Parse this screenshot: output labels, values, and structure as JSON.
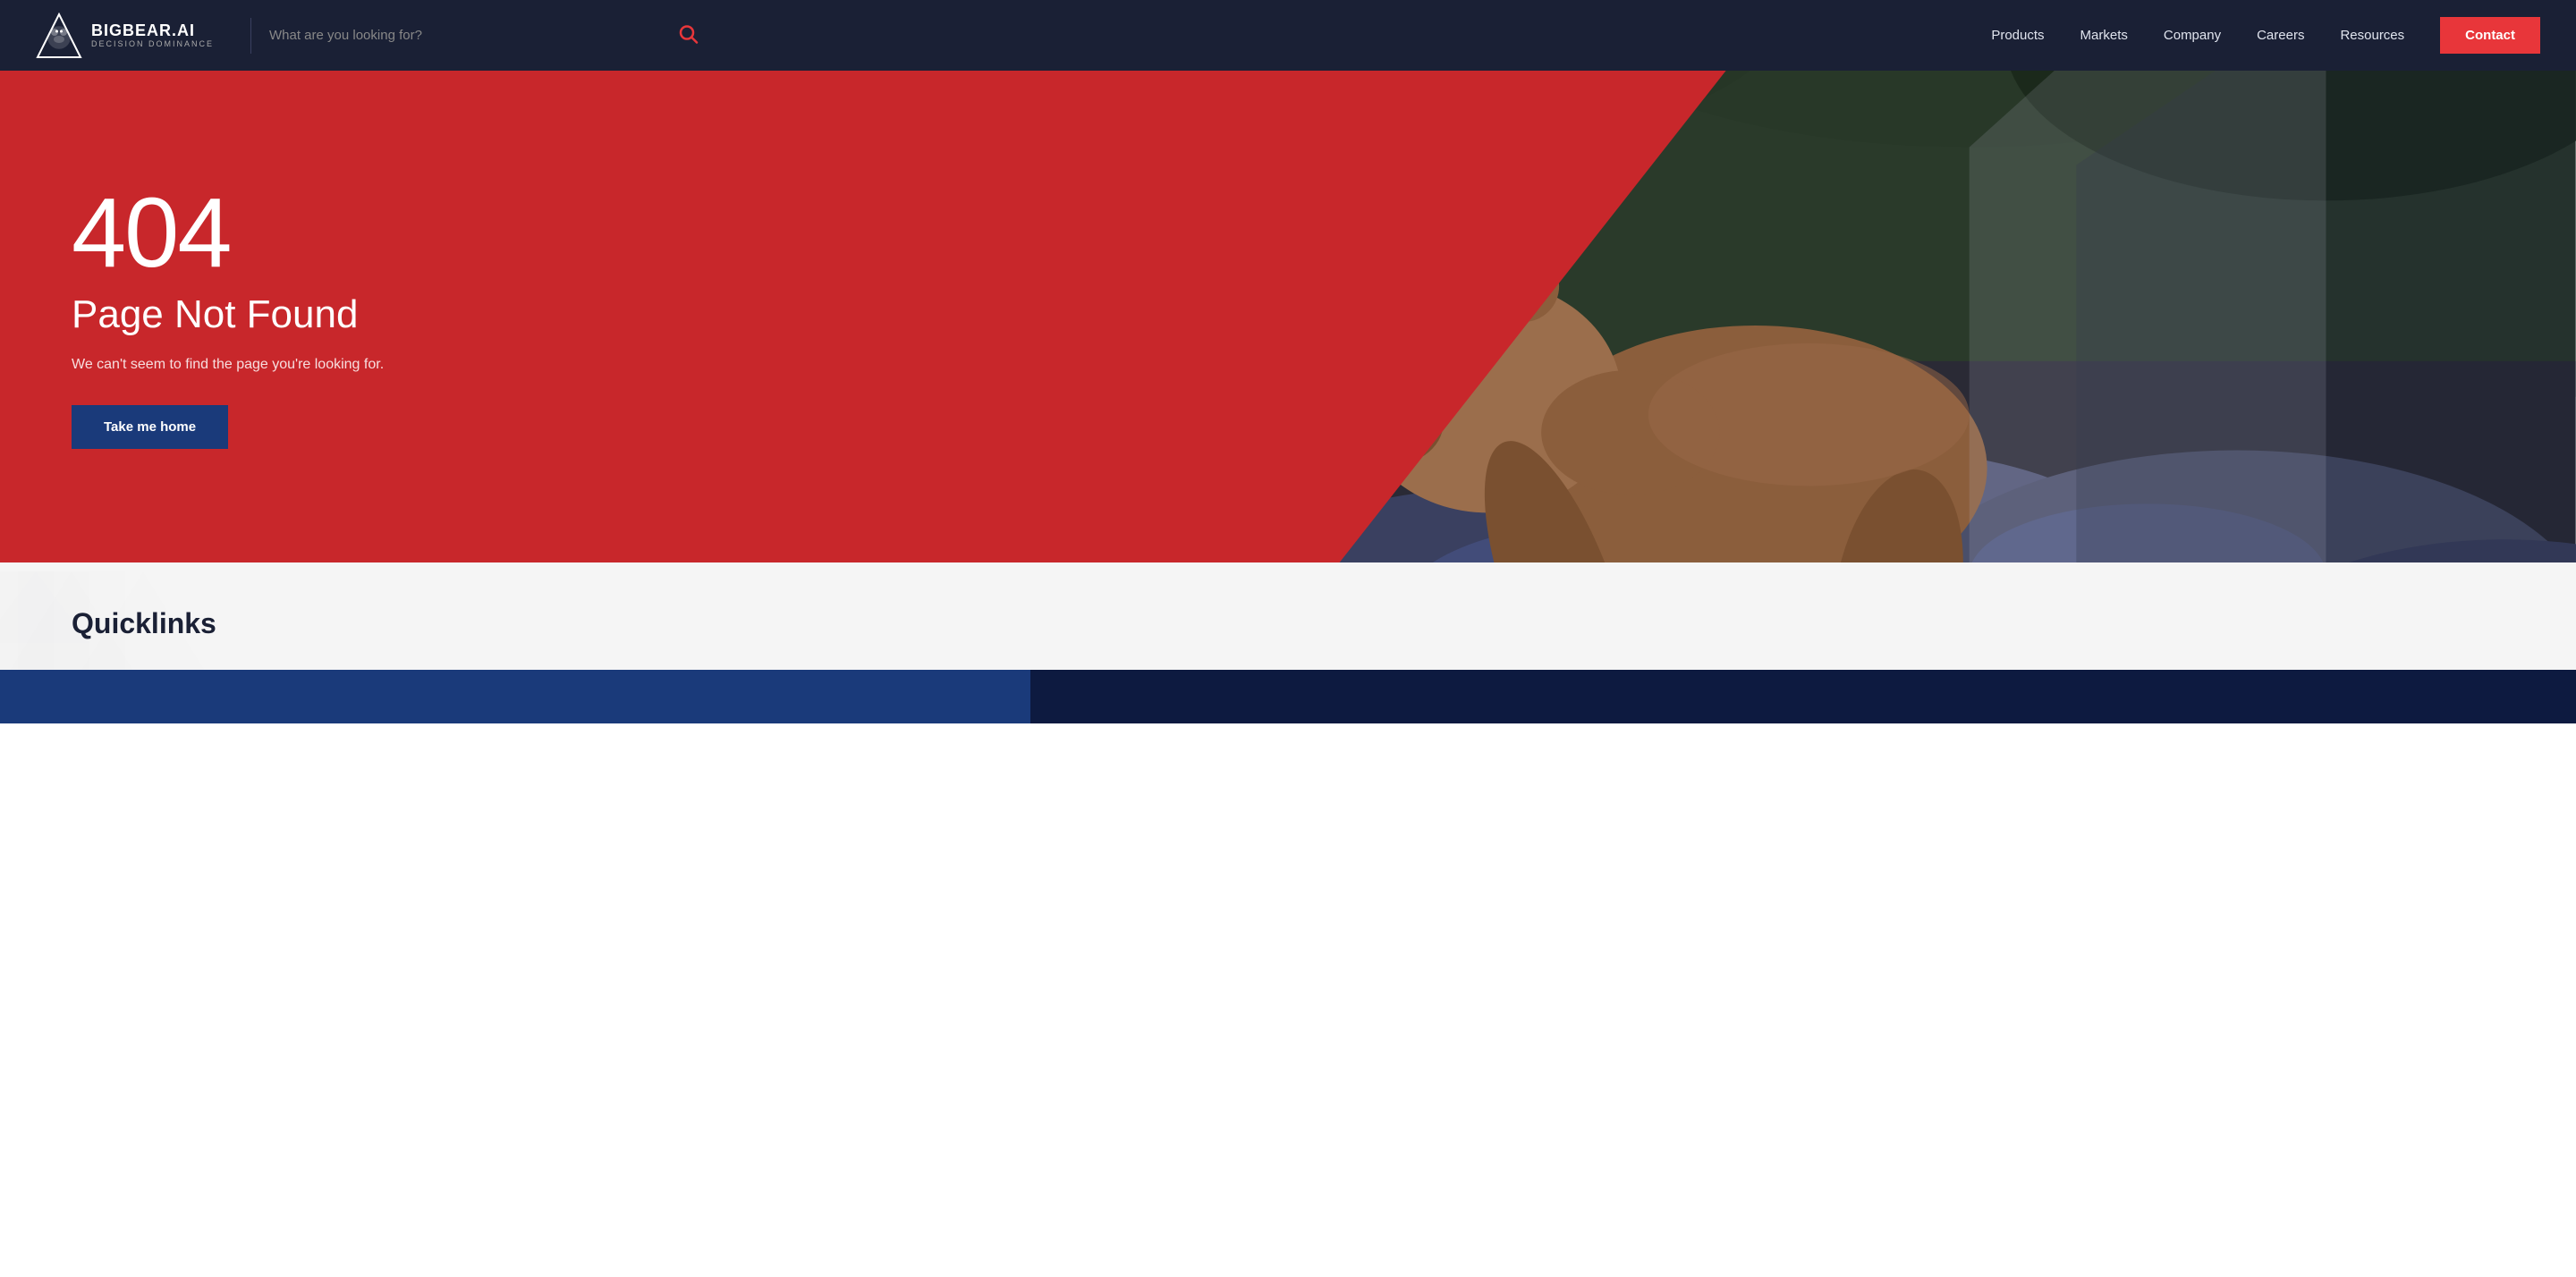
{
  "navbar": {
    "logo": {
      "text": "BIGBEAR.AI",
      "subtext": "DECISION DOMINANCE"
    },
    "search": {
      "placeholder": "What are you looking for?"
    },
    "links": [
      {
        "label": "Products",
        "id": "products"
      },
      {
        "label": "Markets",
        "id": "markets"
      },
      {
        "label": "Company",
        "id": "company"
      },
      {
        "label": "Careers",
        "id": "careers"
      },
      {
        "label": "Resources",
        "id": "resources"
      }
    ],
    "contact_label": "Contact"
  },
  "hero": {
    "error_code": "404",
    "error_title": "Page Not Found",
    "error_desc": "We can't seem to find the page you're looking for.",
    "cta_label": "Take me home"
  },
  "bottom": {
    "quicklinks_title": "Quicklinks"
  }
}
